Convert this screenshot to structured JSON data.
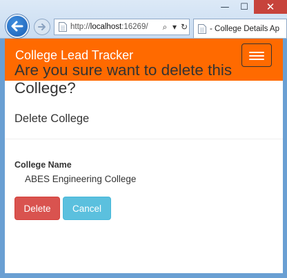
{
  "browser": {
    "url_prefix": "http://",
    "url_host": "localhost",
    "url_rest": ":16269/",
    "tab_title": "- College Details Ap",
    "controls": {
      "minimize": "—",
      "maximize": "☐",
      "close": "✕"
    },
    "address_icons": {
      "search": "⌕",
      "dropdown": "▾",
      "refresh": "↻"
    }
  },
  "navbar": {
    "brand": "College Lead Tracker",
    "accent_color": "#ff6a00"
  },
  "content": {
    "question": "Are you sure want to delete this College?",
    "subtitle": "Delete College",
    "field_label": "College Name",
    "field_value": "ABES Engineering College",
    "delete_label": "Delete",
    "cancel_label": "Cancel"
  }
}
